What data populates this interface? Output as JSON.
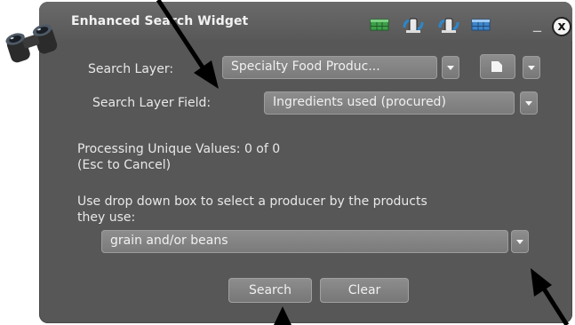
{
  "widget": {
    "title": "Enhanced Search Widget",
    "header_icons": [
      "table-icon",
      "link-icon",
      "link-icon",
      "table-icon"
    ],
    "minimize_label": "_",
    "close_label": "x"
  },
  "search_layer": {
    "label": "Search Layer:",
    "value": "Specialty Food Produc..."
  },
  "search_layer_field": {
    "label": "Search Layer Field:",
    "value": "Ingredients used (procured)"
  },
  "status": {
    "line1": "Processing Unique Values: 0 of 0",
    "line2": "(Esc to Cancel)"
  },
  "instruction": {
    "line1": "Use drop down box to select a producer by the products",
    "line2": "they use:"
  },
  "value_select": {
    "value": "grain and/or beans"
  },
  "buttons": {
    "search": "Search",
    "clear": "Clear"
  },
  "colors": {
    "panel": "#575757",
    "control": "#858585",
    "text": "#e8e8e8",
    "annotation_arrow": "#000000"
  }
}
